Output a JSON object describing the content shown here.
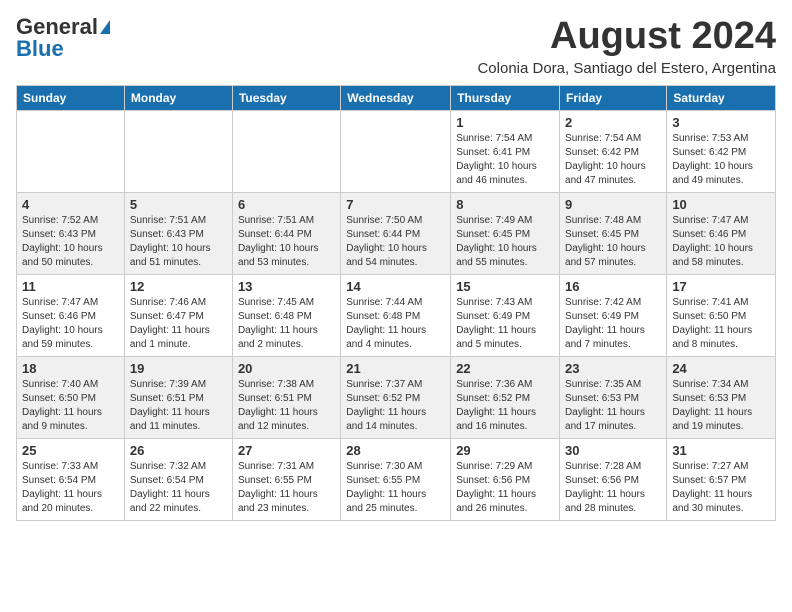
{
  "header": {
    "logo_general": "General",
    "logo_blue": "Blue",
    "month_year": "August 2024",
    "location": "Colonia Dora, Santiago del Estero, Argentina"
  },
  "weekdays": [
    "Sunday",
    "Monday",
    "Tuesday",
    "Wednesday",
    "Thursday",
    "Friday",
    "Saturday"
  ],
  "weeks": [
    [
      {
        "day": "",
        "info": ""
      },
      {
        "day": "",
        "info": ""
      },
      {
        "day": "",
        "info": ""
      },
      {
        "day": "",
        "info": ""
      },
      {
        "day": "1",
        "info": "Sunrise: 7:54 AM\nSunset: 6:41 PM\nDaylight: 10 hours and 46 minutes."
      },
      {
        "day": "2",
        "info": "Sunrise: 7:54 AM\nSunset: 6:42 PM\nDaylight: 10 hours and 47 minutes."
      },
      {
        "day": "3",
        "info": "Sunrise: 7:53 AM\nSunset: 6:42 PM\nDaylight: 10 hours and 49 minutes."
      }
    ],
    [
      {
        "day": "4",
        "info": "Sunrise: 7:52 AM\nSunset: 6:43 PM\nDaylight: 10 hours and 50 minutes."
      },
      {
        "day": "5",
        "info": "Sunrise: 7:51 AM\nSunset: 6:43 PM\nDaylight: 10 hours and 51 minutes."
      },
      {
        "day": "6",
        "info": "Sunrise: 7:51 AM\nSunset: 6:44 PM\nDaylight: 10 hours and 53 minutes."
      },
      {
        "day": "7",
        "info": "Sunrise: 7:50 AM\nSunset: 6:44 PM\nDaylight: 10 hours and 54 minutes."
      },
      {
        "day": "8",
        "info": "Sunrise: 7:49 AM\nSunset: 6:45 PM\nDaylight: 10 hours and 55 minutes."
      },
      {
        "day": "9",
        "info": "Sunrise: 7:48 AM\nSunset: 6:45 PM\nDaylight: 10 hours and 57 minutes."
      },
      {
        "day": "10",
        "info": "Sunrise: 7:47 AM\nSunset: 6:46 PM\nDaylight: 10 hours and 58 minutes."
      }
    ],
    [
      {
        "day": "11",
        "info": "Sunrise: 7:47 AM\nSunset: 6:46 PM\nDaylight: 10 hours and 59 minutes."
      },
      {
        "day": "12",
        "info": "Sunrise: 7:46 AM\nSunset: 6:47 PM\nDaylight: 11 hours and 1 minute."
      },
      {
        "day": "13",
        "info": "Sunrise: 7:45 AM\nSunset: 6:48 PM\nDaylight: 11 hours and 2 minutes."
      },
      {
        "day": "14",
        "info": "Sunrise: 7:44 AM\nSunset: 6:48 PM\nDaylight: 11 hours and 4 minutes."
      },
      {
        "day": "15",
        "info": "Sunrise: 7:43 AM\nSunset: 6:49 PM\nDaylight: 11 hours and 5 minutes."
      },
      {
        "day": "16",
        "info": "Sunrise: 7:42 AM\nSunset: 6:49 PM\nDaylight: 11 hours and 7 minutes."
      },
      {
        "day": "17",
        "info": "Sunrise: 7:41 AM\nSunset: 6:50 PM\nDaylight: 11 hours and 8 minutes."
      }
    ],
    [
      {
        "day": "18",
        "info": "Sunrise: 7:40 AM\nSunset: 6:50 PM\nDaylight: 11 hours and 9 minutes."
      },
      {
        "day": "19",
        "info": "Sunrise: 7:39 AM\nSunset: 6:51 PM\nDaylight: 11 hours and 11 minutes."
      },
      {
        "day": "20",
        "info": "Sunrise: 7:38 AM\nSunset: 6:51 PM\nDaylight: 11 hours and 12 minutes."
      },
      {
        "day": "21",
        "info": "Sunrise: 7:37 AM\nSunset: 6:52 PM\nDaylight: 11 hours and 14 minutes."
      },
      {
        "day": "22",
        "info": "Sunrise: 7:36 AM\nSunset: 6:52 PM\nDaylight: 11 hours and 16 minutes."
      },
      {
        "day": "23",
        "info": "Sunrise: 7:35 AM\nSunset: 6:53 PM\nDaylight: 11 hours and 17 minutes."
      },
      {
        "day": "24",
        "info": "Sunrise: 7:34 AM\nSunset: 6:53 PM\nDaylight: 11 hours and 19 minutes."
      }
    ],
    [
      {
        "day": "25",
        "info": "Sunrise: 7:33 AM\nSunset: 6:54 PM\nDaylight: 11 hours and 20 minutes."
      },
      {
        "day": "26",
        "info": "Sunrise: 7:32 AM\nSunset: 6:54 PM\nDaylight: 11 hours and 22 minutes."
      },
      {
        "day": "27",
        "info": "Sunrise: 7:31 AM\nSunset: 6:55 PM\nDaylight: 11 hours and 23 minutes."
      },
      {
        "day": "28",
        "info": "Sunrise: 7:30 AM\nSunset: 6:55 PM\nDaylight: 11 hours and 25 minutes."
      },
      {
        "day": "29",
        "info": "Sunrise: 7:29 AM\nSunset: 6:56 PM\nDaylight: 11 hours and 26 minutes."
      },
      {
        "day": "30",
        "info": "Sunrise: 7:28 AM\nSunset: 6:56 PM\nDaylight: 11 hours and 28 minutes."
      },
      {
        "day": "31",
        "info": "Sunrise: 7:27 AM\nSunset: 6:57 PM\nDaylight: 11 hours and 30 minutes."
      }
    ]
  ]
}
